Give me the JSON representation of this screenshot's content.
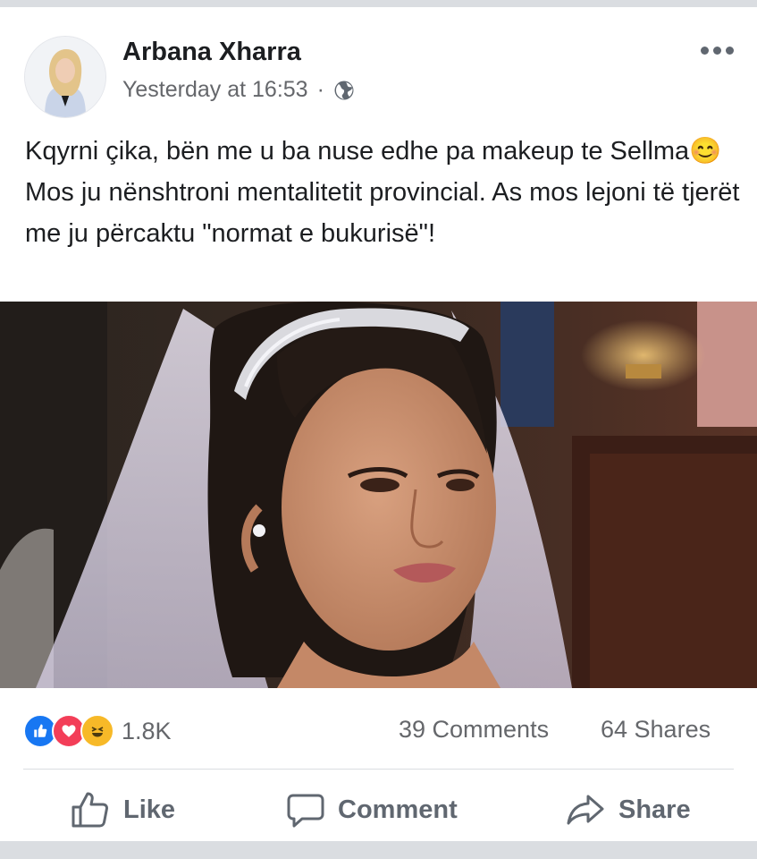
{
  "post": {
    "author": "Arbana Xharra",
    "timestamp": "Yesterday at 16:53",
    "separator": "·",
    "privacy_icon": "globe-icon",
    "text_part1": "Kqyrni çika, bën me u ba nuse edhe pa makeup te Sellma",
    "emoji": "😊",
    "text_part2": " Mos ju nënshtroni mentalitetit provincial. As mos lejoni të tjerët me ju përcaktu \"normat e bukurisë\"!"
  },
  "stats": {
    "reactions": [
      "like-icon",
      "love-icon",
      "haha-icon"
    ],
    "reaction_count": "1.8K",
    "comments": "39 Comments",
    "shares": "64 Shares"
  },
  "actions": {
    "like": "Like",
    "comment": "Comment",
    "share": "Share"
  },
  "colors": {
    "like": "#1877f2",
    "love": "#f33e58",
    "haha": "#f7b928",
    "text": "#1c1e21",
    "muted": "#65676b"
  }
}
